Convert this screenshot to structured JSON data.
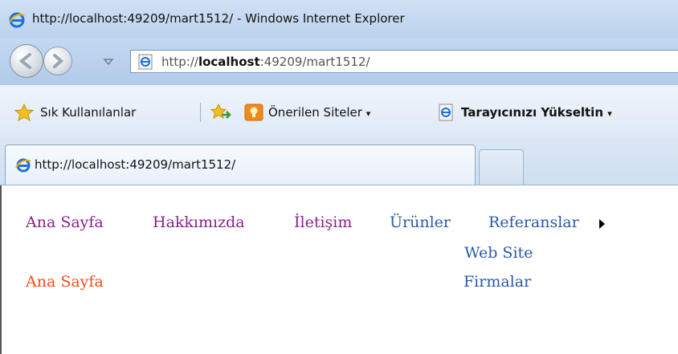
{
  "window": {
    "title": "http://localhost:49209/mart1512/ - Windows Internet Explorer"
  },
  "address_bar": {
    "prefix": "http://",
    "host": "localhost",
    "rest": ":49209/mart1512/"
  },
  "favorites_bar": {
    "favorites_label": "Sık Kullanılanlar",
    "suggested_sites_label": "Önerilen Siteler",
    "upgrade_label": "Tarayıcınızı Yükseltin",
    "caret": "▾"
  },
  "tab": {
    "title": "http://localhost:49209/mart1512/"
  },
  "page": {
    "menu": [
      {
        "label": "Ana Sayfa",
        "state": "visited"
      },
      {
        "label": "Hakkımızda",
        "state": "visited"
      },
      {
        "label": "İletişim",
        "state": "visited"
      },
      {
        "label": "Ürünler",
        "state": "link"
      },
      {
        "label": "Referanslar",
        "state": "link"
      }
    ],
    "submenu": [
      "Web Site",
      "Firmalar"
    ],
    "current_page": "Ana Sayfa"
  },
  "colors": {
    "visited_link": "#8b1f8b",
    "link": "#2a59a9",
    "current_page": "#ff4a1a"
  },
  "icons": [
    "ie-logo-icon",
    "back-arrow-icon",
    "forward-arrow-icon",
    "dropdown-arrow-icon",
    "star-icon",
    "add-favorite-icon",
    "suggested-sites-icon",
    "page-icon",
    "submenu-arrow-icon"
  ]
}
